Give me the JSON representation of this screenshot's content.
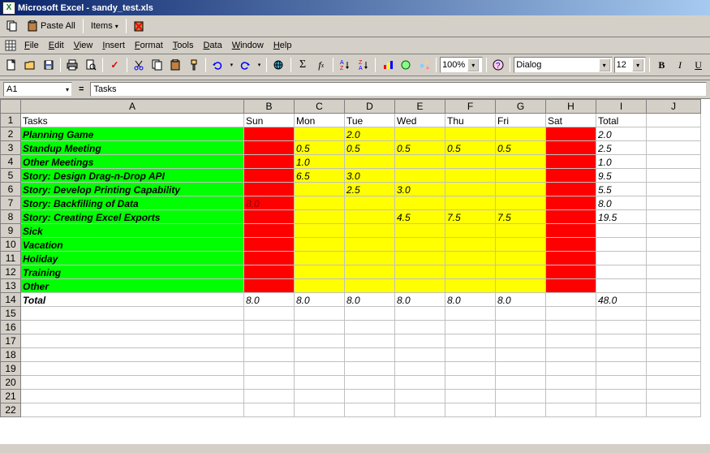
{
  "app": {
    "title": "Microsoft Excel - sandy_test.xls"
  },
  "clipboard_bar": {
    "paste_all": "Paste All",
    "items": "Items"
  },
  "menu": {
    "items": [
      "File",
      "Edit",
      "View",
      "Insert",
      "Format",
      "Tools",
      "Data",
      "Window",
      "Help"
    ]
  },
  "standard_toolbar": {
    "zoom": "100%",
    "font_name": "Dialog",
    "font_size": "12"
  },
  "namebox": {
    "ref": "A1",
    "formula": "Tasks"
  },
  "columns": [
    "A",
    "B",
    "C",
    "D",
    "E",
    "F",
    "G",
    "H",
    "I",
    "J"
  ],
  "row_numbers_extra": [
    15,
    16,
    17,
    18,
    19,
    20,
    21,
    22
  ],
  "sheet": {
    "headers": [
      "Tasks",
      "Sun",
      "Mon",
      "Tue",
      "Wed",
      "Thu",
      "Fri",
      "Sat",
      "Total"
    ],
    "rows": [
      {
        "n": 2,
        "task": "Planning Game",
        "cells": [
          "",
          "",
          "2.0",
          "",
          "",
          "",
          "",
          ""
        ],
        "total": "2.0"
      },
      {
        "n": 3,
        "task": "Standup Meeting",
        "cells": [
          "",
          "0.5",
          "0.5",
          "0.5",
          "0.5",
          "0.5",
          "",
          ""
        ],
        "total": "2.5"
      },
      {
        "n": 4,
        "task": "Other Meetings",
        "cells": [
          "",
          "1.0",
          "",
          "",
          "",
          "",
          "",
          ""
        ],
        "total": "1.0"
      },
      {
        "n": 5,
        "task": "Story: Design Drag-n-Drop API",
        "cells": [
          "",
          "6.5",
          "3.0",
          "",
          "",
          "",
          "",
          ""
        ],
        "total": "9.5"
      },
      {
        "n": 6,
        "task": "Story: Develop Printing Capability",
        "cells": [
          "",
          "",
          "2.5",
          "3.0",
          "",
          "",
          "",
          ""
        ],
        "total": "5.5"
      },
      {
        "n": 7,
        "task": "Story: Backfilling of Data",
        "cells": [
          "8.0",
          "",
          "",
          "",
          "",
          "",
          "",
          ""
        ],
        "total": "8.0",
        "sun_has_text": true
      },
      {
        "n": 8,
        "task": "Story: Creating Excel Exports",
        "cells": [
          "",
          "",
          "",
          "4.5",
          "7.5",
          "7.5",
          "",
          ""
        ],
        "total": "19.5"
      },
      {
        "n": 9,
        "task": "Sick",
        "cells": [
          "",
          "",
          "",
          "",
          "",
          "",
          "",
          ""
        ],
        "total": ""
      },
      {
        "n": 10,
        "task": "Vacation",
        "cells": [
          "",
          "",
          "",
          "",
          "",
          "",
          "",
          ""
        ],
        "total": ""
      },
      {
        "n": 11,
        "task": "Holiday",
        "cells": [
          "",
          "",
          "",
          "",
          "",
          "",
          "",
          ""
        ],
        "total": ""
      },
      {
        "n": 12,
        "task": "Training",
        "cells": [
          "",
          "",
          "",
          "",
          "",
          "",
          "",
          ""
        ],
        "total": ""
      },
      {
        "n": 13,
        "task": "Other",
        "cells": [
          "",
          "",
          "",
          "",
          "",
          "",
          "",
          ""
        ],
        "total": ""
      }
    ],
    "totals": {
      "n": 14,
      "label": "Total",
      "cells": [
        "8.0",
        "8.0",
        "8.0",
        "8.0",
        "8.0",
        "8.0",
        "",
        ""
      ],
      "grand": "48.0"
    }
  }
}
